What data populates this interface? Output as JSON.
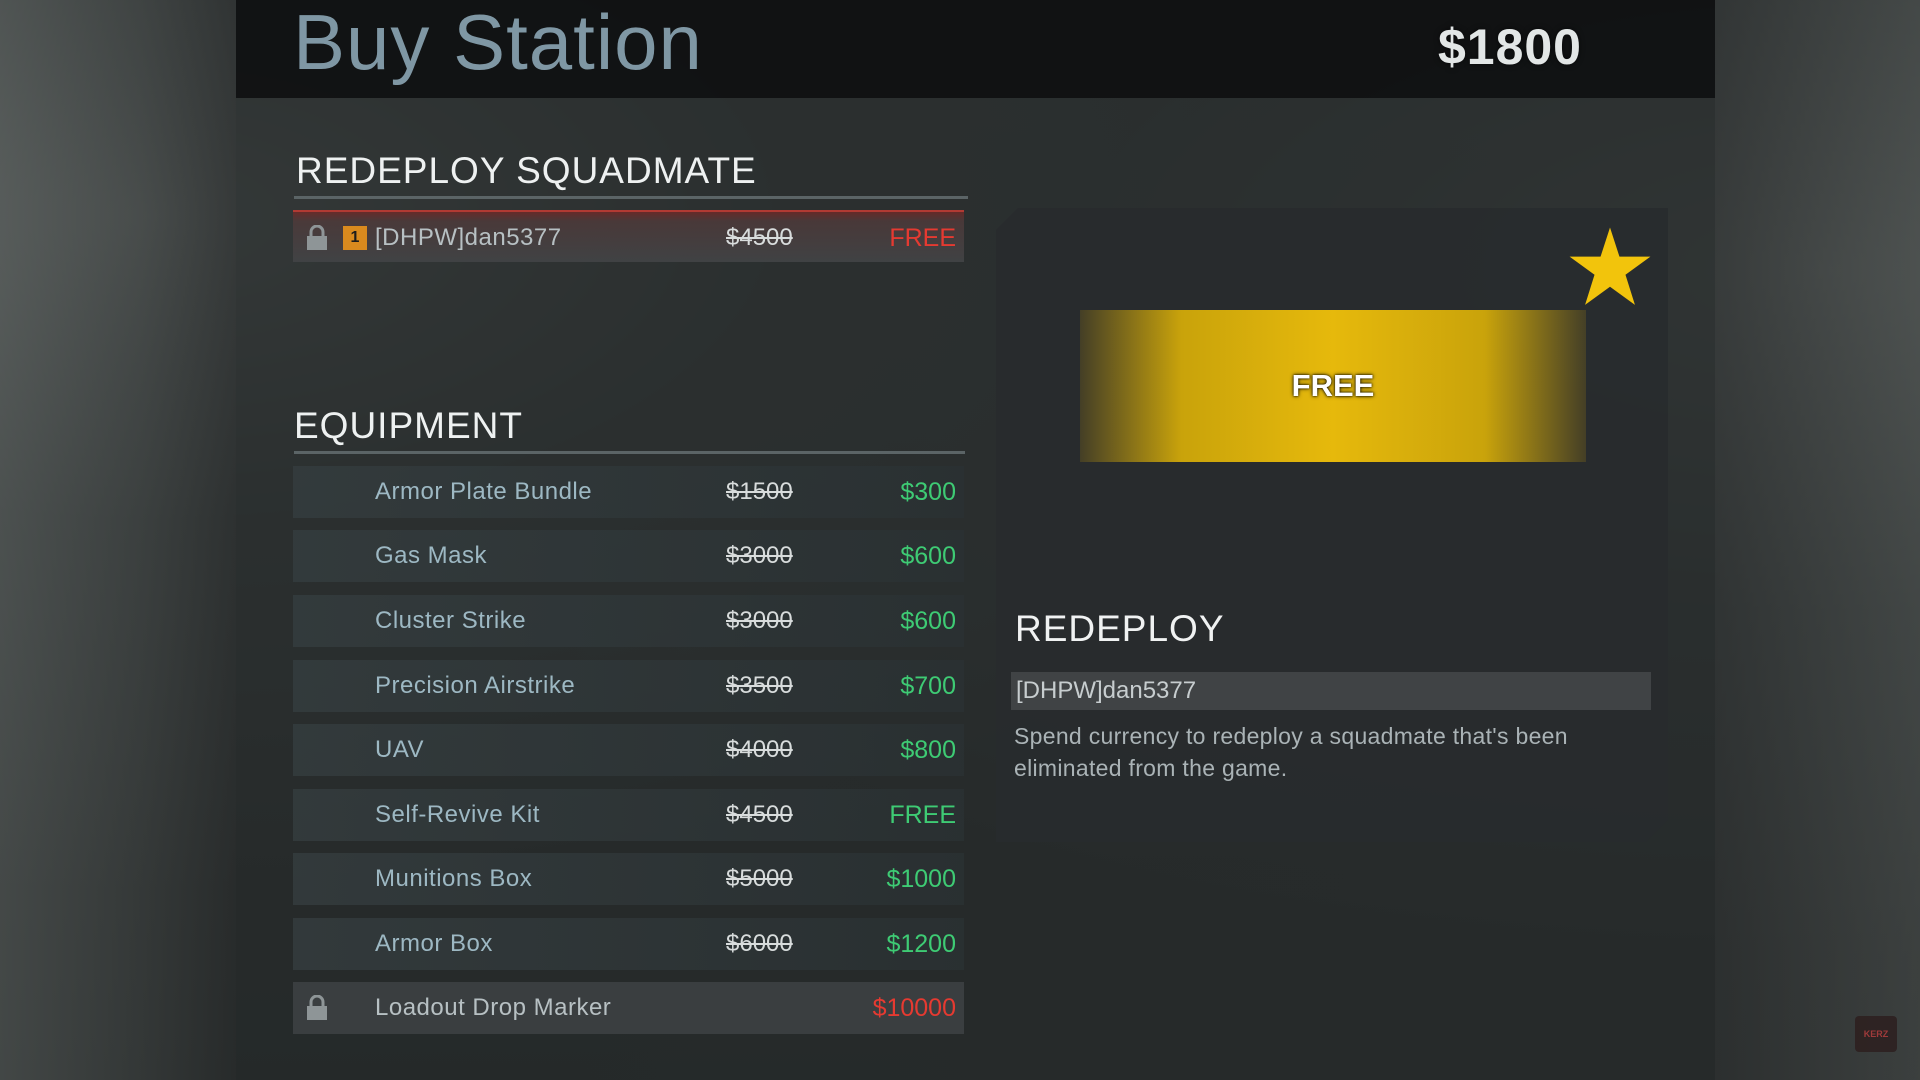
{
  "header": {
    "title": "Buy Station",
    "money": "$1800"
  },
  "sections": {
    "redeploy_title": "REDEPLOY SQUADMATE",
    "equipment_title": "EQUIPMENT"
  },
  "redeploy_rows": [
    {
      "rank": "1",
      "name": "[DHPW]dan5377",
      "old_price": "$4500",
      "price": "FREE",
      "price_color": "red",
      "locked": true,
      "selected": true
    }
  ],
  "equipment_rows": [
    {
      "name": "Armor Plate Bundle",
      "old_price": "$1500",
      "price": "$300"
    },
    {
      "name": "Gas Mask",
      "old_price": "$3000",
      "price": "$600"
    },
    {
      "name": "Cluster Strike",
      "old_price": "$3000",
      "price": "$600"
    },
    {
      "name": "Precision Airstrike",
      "old_price": "$3500",
      "price": "$700"
    },
    {
      "name": "UAV",
      "old_price": "$4000",
      "price": "$800"
    },
    {
      "name": "Self-Revive Kit",
      "old_price": "$4500",
      "price": "FREE"
    },
    {
      "name": "Munitions Box",
      "old_price": "$5000",
      "price": "$1000"
    },
    {
      "name": "Armor Box",
      "old_price": "$6000",
      "price": "$1200"
    }
  ],
  "locked_row": {
    "name": "Loadout Drop Marker",
    "price": "$10000",
    "price_color": "red"
  },
  "detail": {
    "banner_text": "FREE",
    "banner_icon": "star-icon",
    "title": "REDEPLOY",
    "target_name": "[DHPW]dan5377",
    "description": "Spend currency to redeploy a squadmate that's been eliminated from the game."
  },
  "colors": {
    "discount_green": "#3ecb74",
    "alert_red": "#e53a31",
    "gold": "#e6b90c",
    "title_blue": "#7f97a4"
  },
  "watermark": "KERZ"
}
